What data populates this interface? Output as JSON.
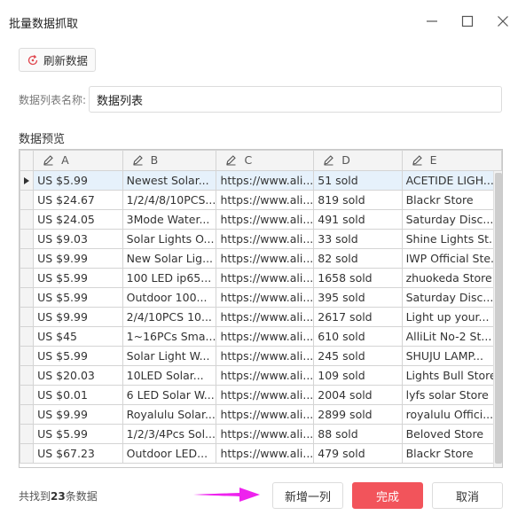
{
  "window": {
    "title": "批量数据抓取"
  },
  "toolbar": {
    "refresh_label": "刷新数据"
  },
  "list_name": {
    "label": "数据列表名称:",
    "value": "数据列表"
  },
  "preview": {
    "label": "数据预览",
    "columns": [
      "A",
      "B",
      "C",
      "D",
      "E"
    ],
    "rows": [
      [
        "US $5.99",
        "Newest Solar...",
        "https://www.ali...",
        "51 sold",
        "ACETIDE LIGH..."
      ],
      [
        "US $24.67",
        "1/2/4/8/10PCS...",
        "https://www.ali...",
        "819 sold",
        "Blackr Store"
      ],
      [
        "US $24.05",
        "3Mode Water...",
        "https://www.ali...",
        "491 sold",
        "Saturday Disc..."
      ],
      [
        "US $9.03",
        "Solar Lights O...",
        "https://www.ali...",
        "33 sold",
        "Shine Lights St..."
      ],
      [
        "US $9.99",
        "New Solar Lig...",
        "https://www.ali...",
        "82 sold",
        "IWP Official Ste..."
      ],
      [
        "US $5.99",
        "100 LED ip65...",
        "https://www.ali...",
        "1658 sold",
        "zhuokeda Store"
      ],
      [
        "US $5.99",
        "Outdoor 100...",
        "https://www.ali...",
        "395 sold",
        "Saturday Disc..."
      ],
      [
        "US $9.99",
        "2/4/10PCS 10...",
        "https://www.ali...",
        "2617 sold",
        "Light up your..."
      ],
      [
        "US $45",
        "1~16PCs Sma...",
        "https://www.ali...",
        "610 sold",
        "AlliLit No-2 St..."
      ],
      [
        "US $5.99",
        "Solar Light W...",
        "https://www.ali...",
        "245 sold",
        "SHUJU LAMP..."
      ],
      [
        "US $20.03",
        "10LED Solar...",
        "https://www.ali...",
        "109 sold",
        "Lights Bull Store"
      ],
      [
        "US $0.01",
        "6 LED Solar W...",
        "https://www.ali...",
        "2004 sold",
        "lyfs solar Store"
      ],
      [
        "US $9.99",
        "Royalulu Solar...",
        "https://www.ali...",
        "2899 sold",
        "royalulu Offici..."
      ],
      [
        "US $5.99",
        "1/2/3/4Pcs Sol...",
        "https://www.ali...",
        "88 sold",
        "Beloved Store"
      ],
      [
        "US $67.23",
        "Outdoor LED...",
        "https://www.ali...",
        "479 sold",
        "Blackr Store"
      ]
    ]
  },
  "footer": {
    "found_prefix": "共找到",
    "found_count": "23",
    "found_suffix": "条数据",
    "add_column_label": "新增一列",
    "done_label": "完成",
    "cancel_label": "取消"
  },
  "colors": {
    "accent": "#f2545b",
    "arrow": "#ee22ee",
    "selected_row": "#e6f1fb"
  },
  "icons": {
    "refresh": "refresh-icon",
    "column_edit": "pencil-icon"
  }
}
